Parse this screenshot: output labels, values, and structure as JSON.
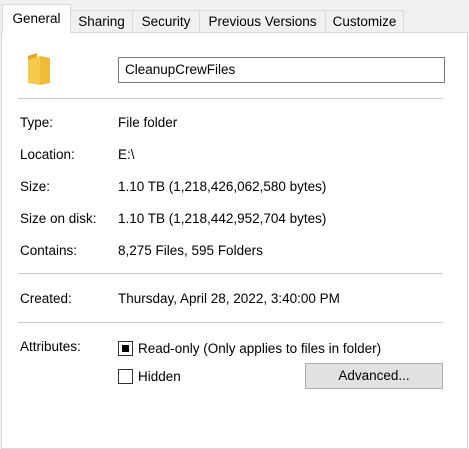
{
  "tabs": [
    {
      "label": "General",
      "active": true
    },
    {
      "label": "Sharing",
      "active": false
    },
    {
      "label": "Security",
      "active": false
    },
    {
      "label": "Previous Versions",
      "active": false
    },
    {
      "label": "Customize",
      "active": false
    }
  ],
  "folder_icon": "folder-icon",
  "name_field": {
    "value": "CleanupCrewFiles"
  },
  "properties": {
    "type": {
      "label": "Type:",
      "value": "File folder"
    },
    "location": {
      "label": "Location:",
      "value": "E:\\"
    },
    "size": {
      "label": "Size:",
      "value": "1.10 TB (1,218,426,062,580 bytes)"
    },
    "size_on_disk": {
      "label": "Size on disk:",
      "value": "1.10 TB (1,218,442,952,704 bytes)"
    },
    "contains": {
      "label": "Contains:",
      "value": "8,275 Files, 595 Folders"
    },
    "created": {
      "label": "Created:",
      "value": "Thursday, April 28, 2022, 3:40:00 PM"
    }
  },
  "attributes": {
    "label": "Attributes:",
    "readonly": {
      "label": "Read-only (Only applies to files in folder)",
      "state": "indeterminate"
    },
    "hidden": {
      "label": "Hidden",
      "state": "unchecked"
    },
    "advanced_button": "Advanced..."
  },
  "colors": {
    "folder_yellow": "#f5c94a",
    "folder_dark": "#e0a92b",
    "panel_bg": "#ffffff",
    "window_bg": "#f0f0f0"
  }
}
